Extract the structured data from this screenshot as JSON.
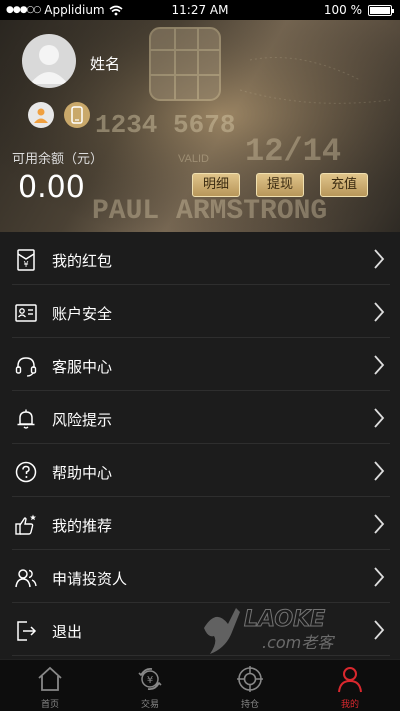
{
  "status_bar": {
    "carrier": "Applidium",
    "time": "11:27 AM",
    "battery": "100 %"
  },
  "header": {
    "username": "姓名",
    "balance_label": "可用余额（元）",
    "balance_value": "0.00",
    "buttons": [
      "明细",
      "提现",
      "充值"
    ],
    "card_text": [
      "1234 5678",
      "12/14",
      "PAUL ARMSTRONG",
      "VALID"
    ]
  },
  "menu": {
    "items": [
      {
        "label": "我的红包",
        "icon": "red-envelope-icon"
      },
      {
        "label": "账户安全",
        "icon": "id-card-icon"
      },
      {
        "label": "客服中心",
        "icon": "headset-icon"
      },
      {
        "label": "风险提示",
        "icon": "bell-icon"
      },
      {
        "label": "帮助中心",
        "icon": "help-icon"
      },
      {
        "label": "我的推荐",
        "icon": "thumbs-up-icon"
      },
      {
        "label": "申请投资人",
        "icon": "users-icon"
      },
      {
        "label": "退出",
        "icon": "logout-icon"
      }
    ]
  },
  "watermark": {
    "text": "LAOKE",
    "sub": ".com老客"
  },
  "tabbar": {
    "tabs": [
      {
        "label": "首页",
        "icon": "home-icon"
      },
      {
        "label": "交易",
        "icon": "trade-icon"
      },
      {
        "label": "持仓",
        "icon": "position-icon"
      },
      {
        "label": "我的",
        "icon": "profile-icon",
        "active": true
      }
    ],
    "active_color": "#d9282e"
  }
}
